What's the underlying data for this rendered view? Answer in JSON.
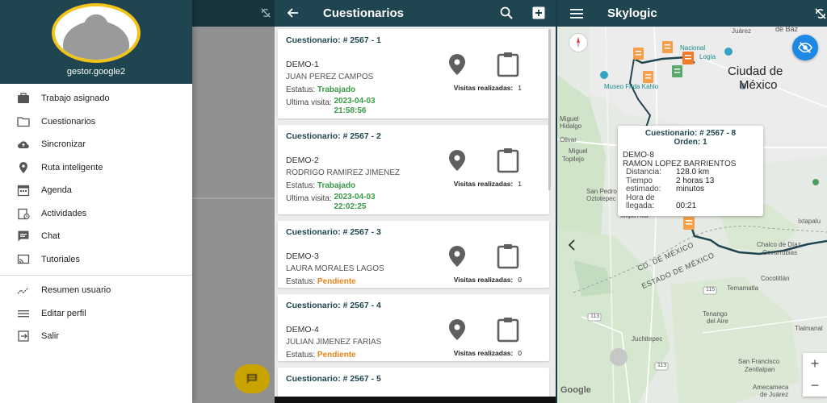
{
  "colors": {
    "primary": "#1f4650",
    "accent_yellow": "#f2c318",
    "status_green": "#3a9a47",
    "status_orange": "#e8861c",
    "map_blue": "#1e88e5"
  },
  "drawer": {
    "username": "gestor.google2",
    "items": [
      {
        "label": "Trabajo asignado",
        "icon": "briefcase-icon"
      },
      {
        "label": "Cuestionarios",
        "icon": "folder-icon"
      },
      {
        "label": "Sincronizar",
        "icon": "cloud-upload-icon"
      },
      {
        "label": "Ruta inteligente",
        "icon": "location-pin-icon"
      },
      {
        "label": "Agenda",
        "icon": "calendar-icon"
      },
      {
        "label": "Actividades",
        "icon": "activity-clipboard-icon"
      },
      {
        "label": "Chat",
        "icon": "chat-bubble-icon"
      },
      {
        "label": "Tutoriales",
        "icon": "cast-icon"
      }
    ],
    "secondary_items": [
      {
        "label": "Resumen usuario",
        "icon": "trend-icon"
      },
      {
        "label": "Editar perfil",
        "icon": "lines-icon"
      },
      {
        "label": "Salir",
        "icon": "exit-icon"
      }
    ]
  },
  "questionnaires": {
    "title": "Cuestionarios",
    "status_label": "Estatus:",
    "last_visit_label": "Ultima visita:",
    "visits_label": "Visitas realizadas:",
    "cards": [
      {
        "header": "Cuestionario: # 2567 - 1",
        "demo": "DEMO-1",
        "person": "JUAN PEREZ CAMPOS",
        "status": "Trabajado",
        "last_visit_date": "2023-04-03",
        "last_visit_time": "21:58:56",
        "visits": "1"
      },
      {
        "header": "Cuestionario: # 2567 - 2",
        "demo": "DEMO-2",
        "person": "RODRIGO RAMIREZ JIMENEZ",
        "status": "Trabajado",
        "last_visit_date": "2023-04-03",
        "last_visit_time": "22:02:25",
        "visits": "1"
      },
      {
        "header": "Cuestionario: # 2567 - 3",
        "demo": "DEMO-3",
        "person": "LAURA MORALES LAGOS",
        "status": "Pendiente",
        "visits": "0"
      },
      {
        "header": "Cuestionario: # 2567 - 4",
        "demo": "DEMO-4",
        "person": "JULIAN JIMENEZ FARIAS",
        "status": "Pendiente",
        "visits": "0"
      },
      {
        "header": "Cuestionario: # 2567 - 5"
      }
    ]
  },
  "map_screen": {
    "title": "Skylogic",
    "info_window": {
      "title_line1": "Cuestionario: # 2567 - 8",
      "title_line2": "Orden: 1",
      "demo": "DEMO-8",
      "person": "RAMON LOPEZ BARRIENTOS",
      "distance_label": "Distancia:",
      "distance_value": "128.0 km",
      "time_label_1": "Tiempo",
      "time_label_2": "estimado:",
      "time_value_1": "2 horas 13",
      "time_value_2": "minutos",
      "arrival_label_1": "Hora de",
      "arrival_label_2": "llegada:",
      "arrival_value": "00:21"
    },
    "labels": {
      "city": "Ciudad de",
      "city2": "México",
      "juarez": "Juárez",
      "baz": "de Baz",
      "nacional": "Nacional",
      "logia": "Logía",
      "frida": "Museo Frida Kahlo",
      "miguel": "Miguel",
      "hidalgo": "Hidalgo",
      "olivar": "Olivar",
      "miguel2": "Miguel",
      "topilejo": "Topilejo",
      "san_pedro": "San Pedro",
      "oztotepec": "Oztotepec",
      "milpa": "Milpa Alta",
      "cd_mexico": "CD. DE MÉXICO",
      "estado_mexico": "ESTADO DE MÉXICO",
      "tlalnepantla": "Ixtapalu",
      "chalco": "Chalco de Díaz",
      "covarrubias": "Covarrubias",
      "cocotitlan": "Cocotitlán",
      "temamatla": "Temamatla",
      "tenango": "Tenango",
      "del_aire": "del Aire",
      "juchitepec": "Juchitepec",
      "tlalmanalco": "Tlalmanal",
      "san_francisco": "San Francisco",
      "zentlalpan": "Zentlalpan",
      "amecameca": "Amecameca",
      "juarez2": "de Juárez",
      "route113a": "113",
      "route113b": "113",
      "route115": "115",
      "google": "Google"
    },
    "zoom_in": "+",
    "zoom_out": "−"
  }
}
